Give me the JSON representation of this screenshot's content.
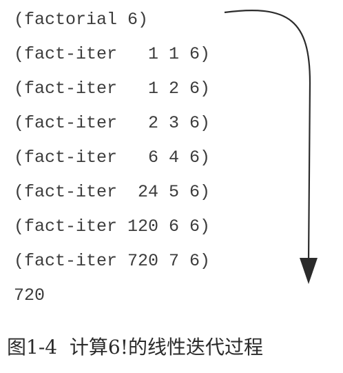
{
  "trace": {
    "lines": [
      "(factorial 6)",
      "(fact-iter   1 1 6)",
      "(fact-iter   1 2 6)",
      "(fact-iter   2 3 6)",
      "(fact-iter   6 4 6)",
      "(fact-iter  24 5 6)",
      "(fact-iter 120 6 6)",
      "(fact-iter 720 7 6)",
      "720"
    ]
  },
  "caption": "图1-4  计算6!的线性迭代过程",
  "colors": {
    "text": "#3c3c3c",
    "arrow": "#2b2b2b",
    "background": "#ffffff"
  },
  "icons": {
    "flow_arrow": "curved-down-arrow-icon"
  }
}
